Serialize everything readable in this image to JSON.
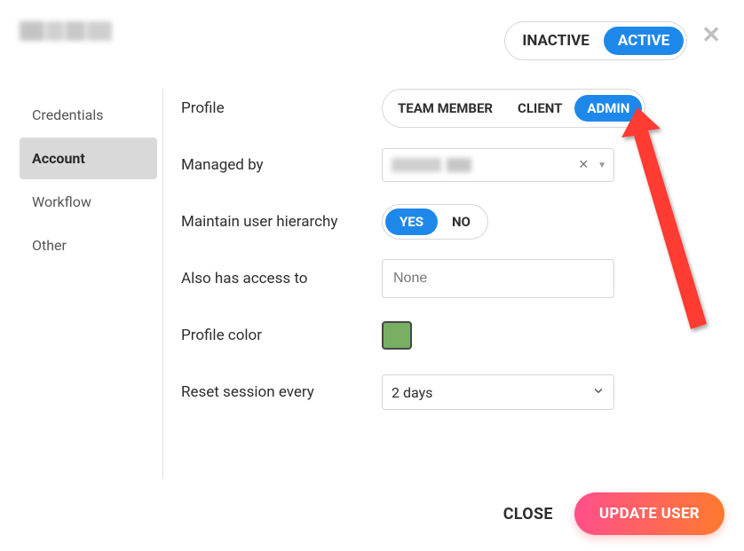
{
  "header": {
    "status_toggle": {
      "inactive": "INACTIVE",
      "active": "ACTIVE",
      "selected": "ACTIVE"
    }
  },
  "sidebar": {
    "items": [
      {
        "label": "Credentials"
      },
      {
        "label": "Account"
      },
      {
        "label": "Workflow"
      },
      {
        "label": "Other"
      }
    ],
    "active_index": 1
  },
  "form": {
    "profile": {
      "label": "Profile",
      "options": {
        "team_member": "TEAM MEMBER",
        "client": "CLIENT",
        "admin": "ADMIN"
      },
      "selected": "ADMIN"
    },
    "managed_by": {
      "label": "Managed by",
      "clear_title": "Clear"
    },
    "maintain_hierarchy": {
      "label": "Maintain user hierarchy",
      "options": {
        "yes": "YES",
        "no": "NO"
      },
      "selected": "YES"
    },
    "also_access": {
      "label": "Also has access to",
      "placeholder": "None",
      "value": ""
    },
    "profile_color": {
      "label": "Profile color",
      "value": "#78af63"
    },
    "reset_session": {
      "label": "Reset session every",
      "value": "2 days"
    }
  },
  "footer": {
    "close": "CLOSE",
    "update": "UPDATE USER"
  }
}
